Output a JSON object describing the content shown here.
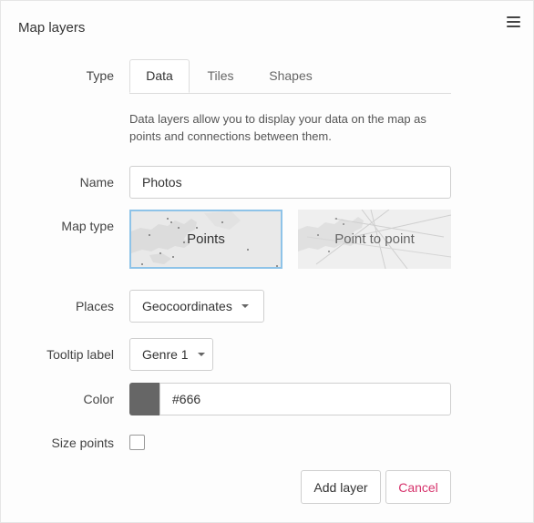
{
  "panel": {
    "title": "Map layers"
  },
  "form": {
    "type_label": "Type",
    "tabs": [
      {
        "label": "Data",
        "active": true
      },
      {
        "label": "Tiles",
        "active": false
      },
      {
        "label": "Shapes",
        "active": false
      }
    ],
    "description": "Data layers allow you to display your data on the map as points and connections between them.",
    "name_label": "Name",
    "name_value": "Photos",
    "map_type_label": "Map type",
    "map_types": [
      {
        "label": "Points",
        "selected": true
      },
      {
        "label": "Point to point",
        "selected": false
      }
    ],
    "places_label": "Places",
    "places_value": "Geocoordinates",
    "tooltip_label": "Tooltip label",
    "tooltip_value": "Genre 1",
    "color_label": "Color",
    "color_value": "#666",
    "size_points_label": "Size points",
    "size_points_checked": false
  },
  "actions": {
    "add_label": "Add layer",
    "cancel_label": "Cancel"
  },
  "colors": {
    "accent_selected_border": "#8ec3e8",
    "cancel_text": "#d6336c",
    "swatch": "#666666"
  },
  "icons": {
    "menu": "hamburger-menu-icon",
    "dropdown": "caret-down-icon"
  }
}
